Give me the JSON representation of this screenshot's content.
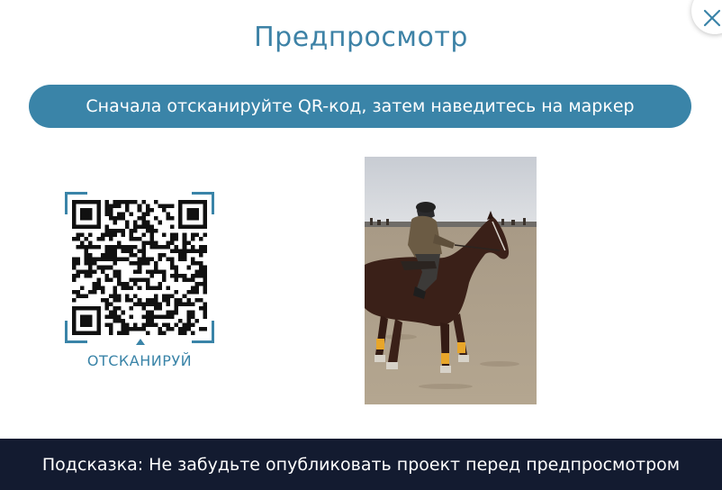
{
  "modal": {
    "title": "Предпросмотр",
    "instruction": "Сначала отсканируйте QR-код, затем наведитесь на маркер",
    "qr": {
      "label": "ОТСКАНИРУЙ"
    },
    "hint": "Подсказка: Не забудьте опубликовать проект перед предпросмотром",
    "close_icon": "close-icon"
  },
  "colors": {
    "accent": "#3a84a8",
    "title": "#3d82a6",
    "hint_bg": "#131b30"
  }
}
